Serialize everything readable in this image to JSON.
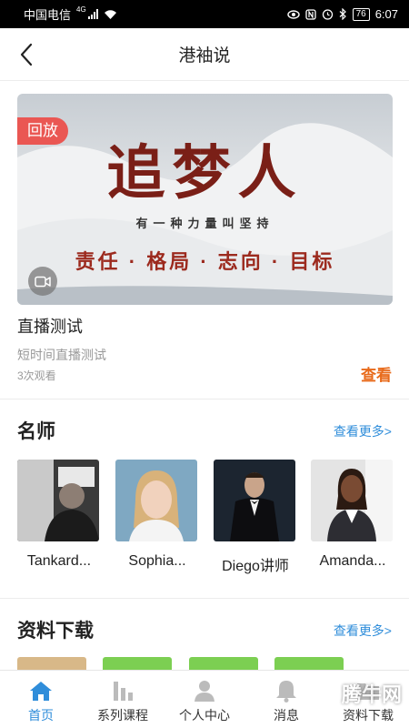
{
  "status_bar": {
    "carrier": "中国电信",
    "network": "4G",
    "battery": "76",
    "time": "6:07"
  },
  "header": {
    "title": "港袖说"
  },
  "banner": {
    "tag": "回放",
    "title": "追梦人",
    "subtitle": "有一种力量叫坚持",
    "slogan": "责任 · 格局 · 志向 · 目标"
  },
  "live": {
    "title": "直播测试",
    "description": "短时间直播测试",
    "views": "3次观看",
    "action": "查看"
  },
  "teachers_section": {
    "title": "名师",
    "more": "查看更多>",
    "teachers": [
      {
        "name": "Tankard..."
      },
      {
        "name": "Sophia..."
      },
      {
        "name": "Diego讲师"
      },
      {
        "name": "Amanda..."
      }
    ]
  },
  "downloads_section": {
    "title": "资料下载",
    "more": "查看更多>"
  },
  "tabs": [
    {
      "label": "首页",
      "icon": "home-icon",
      "active": true
    },
    {
      "label": "系列课程",
      "icon": "bar-chart-icon",
      "active": false
    },
    {
      "label": "个人中心",
      "icon": "person-icon",
      "active": false
    },
    {
      "label": "消息",
      "icon": "bell-icon",
      "active": false
    },
    {
      "label": "资料下载",
      "icon": "folder-icon",
      "active": false
    }
  ],
  "watermark": "腾牛网",
  "colors": {
    "accent": "#2f8dda",
    "view_link": "#e86a1a",
    "replay_tag": "#ea5753"
  }
}
